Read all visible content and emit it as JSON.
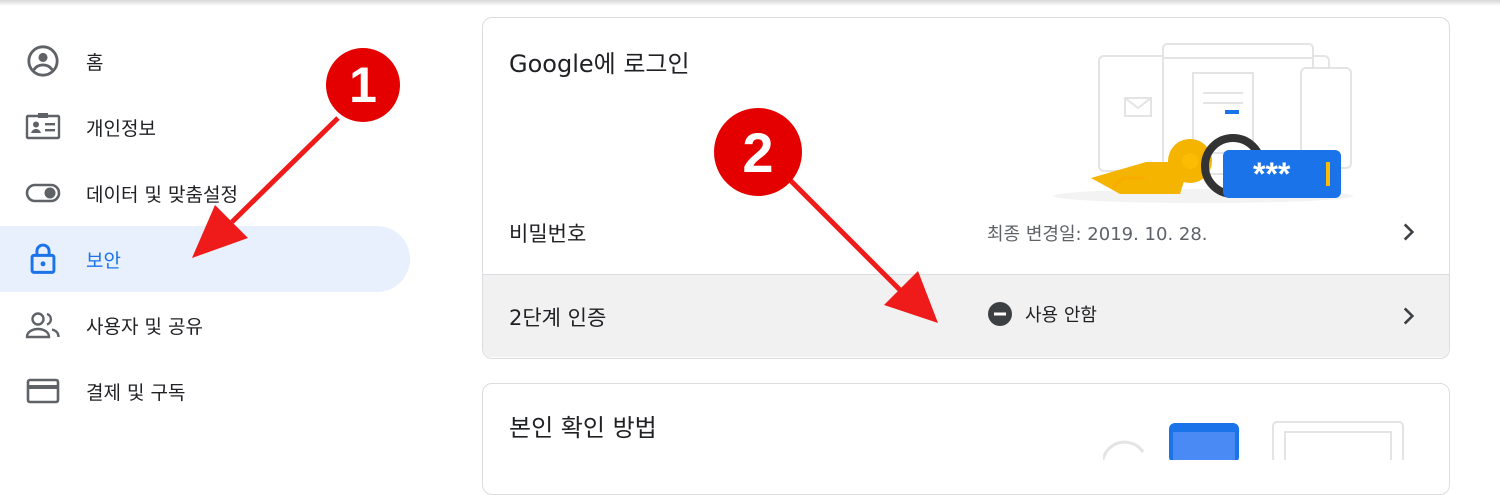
{
  "sidebar": {
    "items": [
      {
        "label": "홈",
        "icon": "account-circle-icon"
      },
      {
        "label": "개인정보",
        "icon": "id-card-icon"
      },
      {
        "label": "데이터 및 맞춤설정",
        "icon": "toggle-icon"
      },
      {
        "label": "보안",
        "icon": "lock-icon",
        "active": true
      },
      {
        "label": "사용자 및 공유",
        "icon": "people-icon"
      },
      {
        "label": "결제 및 구독",
        "icon": "credit-card-icon"
      }
    ]
  },
  "signin_card": {
    "title": "Google에 로그인",
    "password_row": {
      "label": "비밀번호",
      "value": "최종 변경일: 2019. 10. 28."
    },
    "two_step_row": {
      "label": "2단계 인증",
      "status": "사용 안함"
    },
    "illustration_text": "***"
  },
  "verify_card": {
    "title": "본인 확인 방법"
  },
  "annotations": {
    "badge_1": "1",
    "badge_2": "2"
  },
  "colors": {
    "accent": "#1a73e8",
    "active_bg": "#e8f0fe",
    "callout": "#e50000",
    "row_highlight": "#f1f1f1"
  }
}
